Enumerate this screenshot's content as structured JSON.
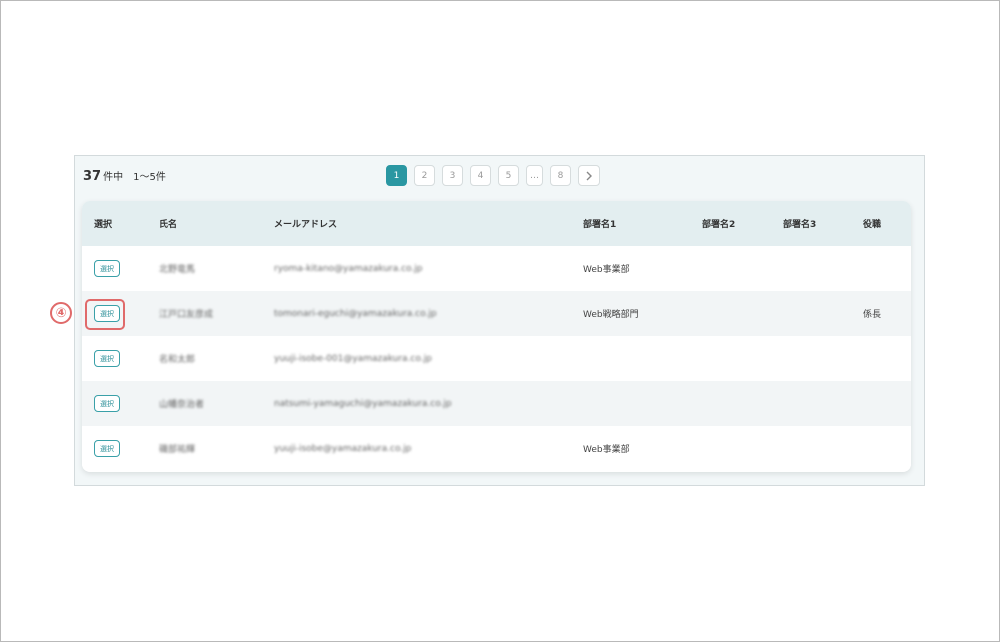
{
  "pagination": {
    "total": "37",
    "total_suffix": "件中",
    "range": "1～5件",
    "pages": [
      "1",
      "2",
      "3",
      "4",
      "5",
      "…",
      "8"
    ],
    "active_page": "1",
    "next_icon": "chevron-right-icon"
  },
  "table": {
    "headers": [
      "選択",
      "氏名",
      "メールアドレス",
      "部署名1",
      "部署名2",
      "部署名3",
      "役職"
    ],
    "select_label": "選択",
    "rows": [
      {
        "name": "北野竜馬",
        "email": "ryoma-kitano@yamazakura.co.jp",
        "dept1": "Web事業部",
        "dept2": "",
        "dept3": "",
        "title": ""
      },
      {
        "name": "江戸口友彦成",
        "email": "tomonari-eguchi@yamazakura.co.jp",
        "dept1": "Web戦略部門",
        "dept2": "",
        "dept3": "",
        "title": "係長"
      },
      {
        "name": "名和太郎",
        "email": "yuuji-isobe-001@yamazakura.co.jp",
        "dept1": "",
        "dept2": "",
        "dept3": "",
        "title": ""
      },
      {
        "name": "山幡奈治者",
        "email": "natsumi-yamaguchi@yamazakura.co.jp",
        "dept1": "",
        "dept2": "",
        "dept3": "",
        "title": ""
      },
      {
        "name": "磯部祐輝",
        "email": "yuuji-isobe@yamazakura.co.jp",
        "dept1": "Web事業部",
        "dept2": "",
        "dept3": "",
        "title": ""
      }
    ]
  },
  "annotation": {
    "step_marker": "④",
    "color": "#e06a6a"
  },
  "colors": {
    "accent": "#2a97a2",
    "header_bg": "#e3eef0",
    "panel_bg": "#f2f7f8"
  }
}
